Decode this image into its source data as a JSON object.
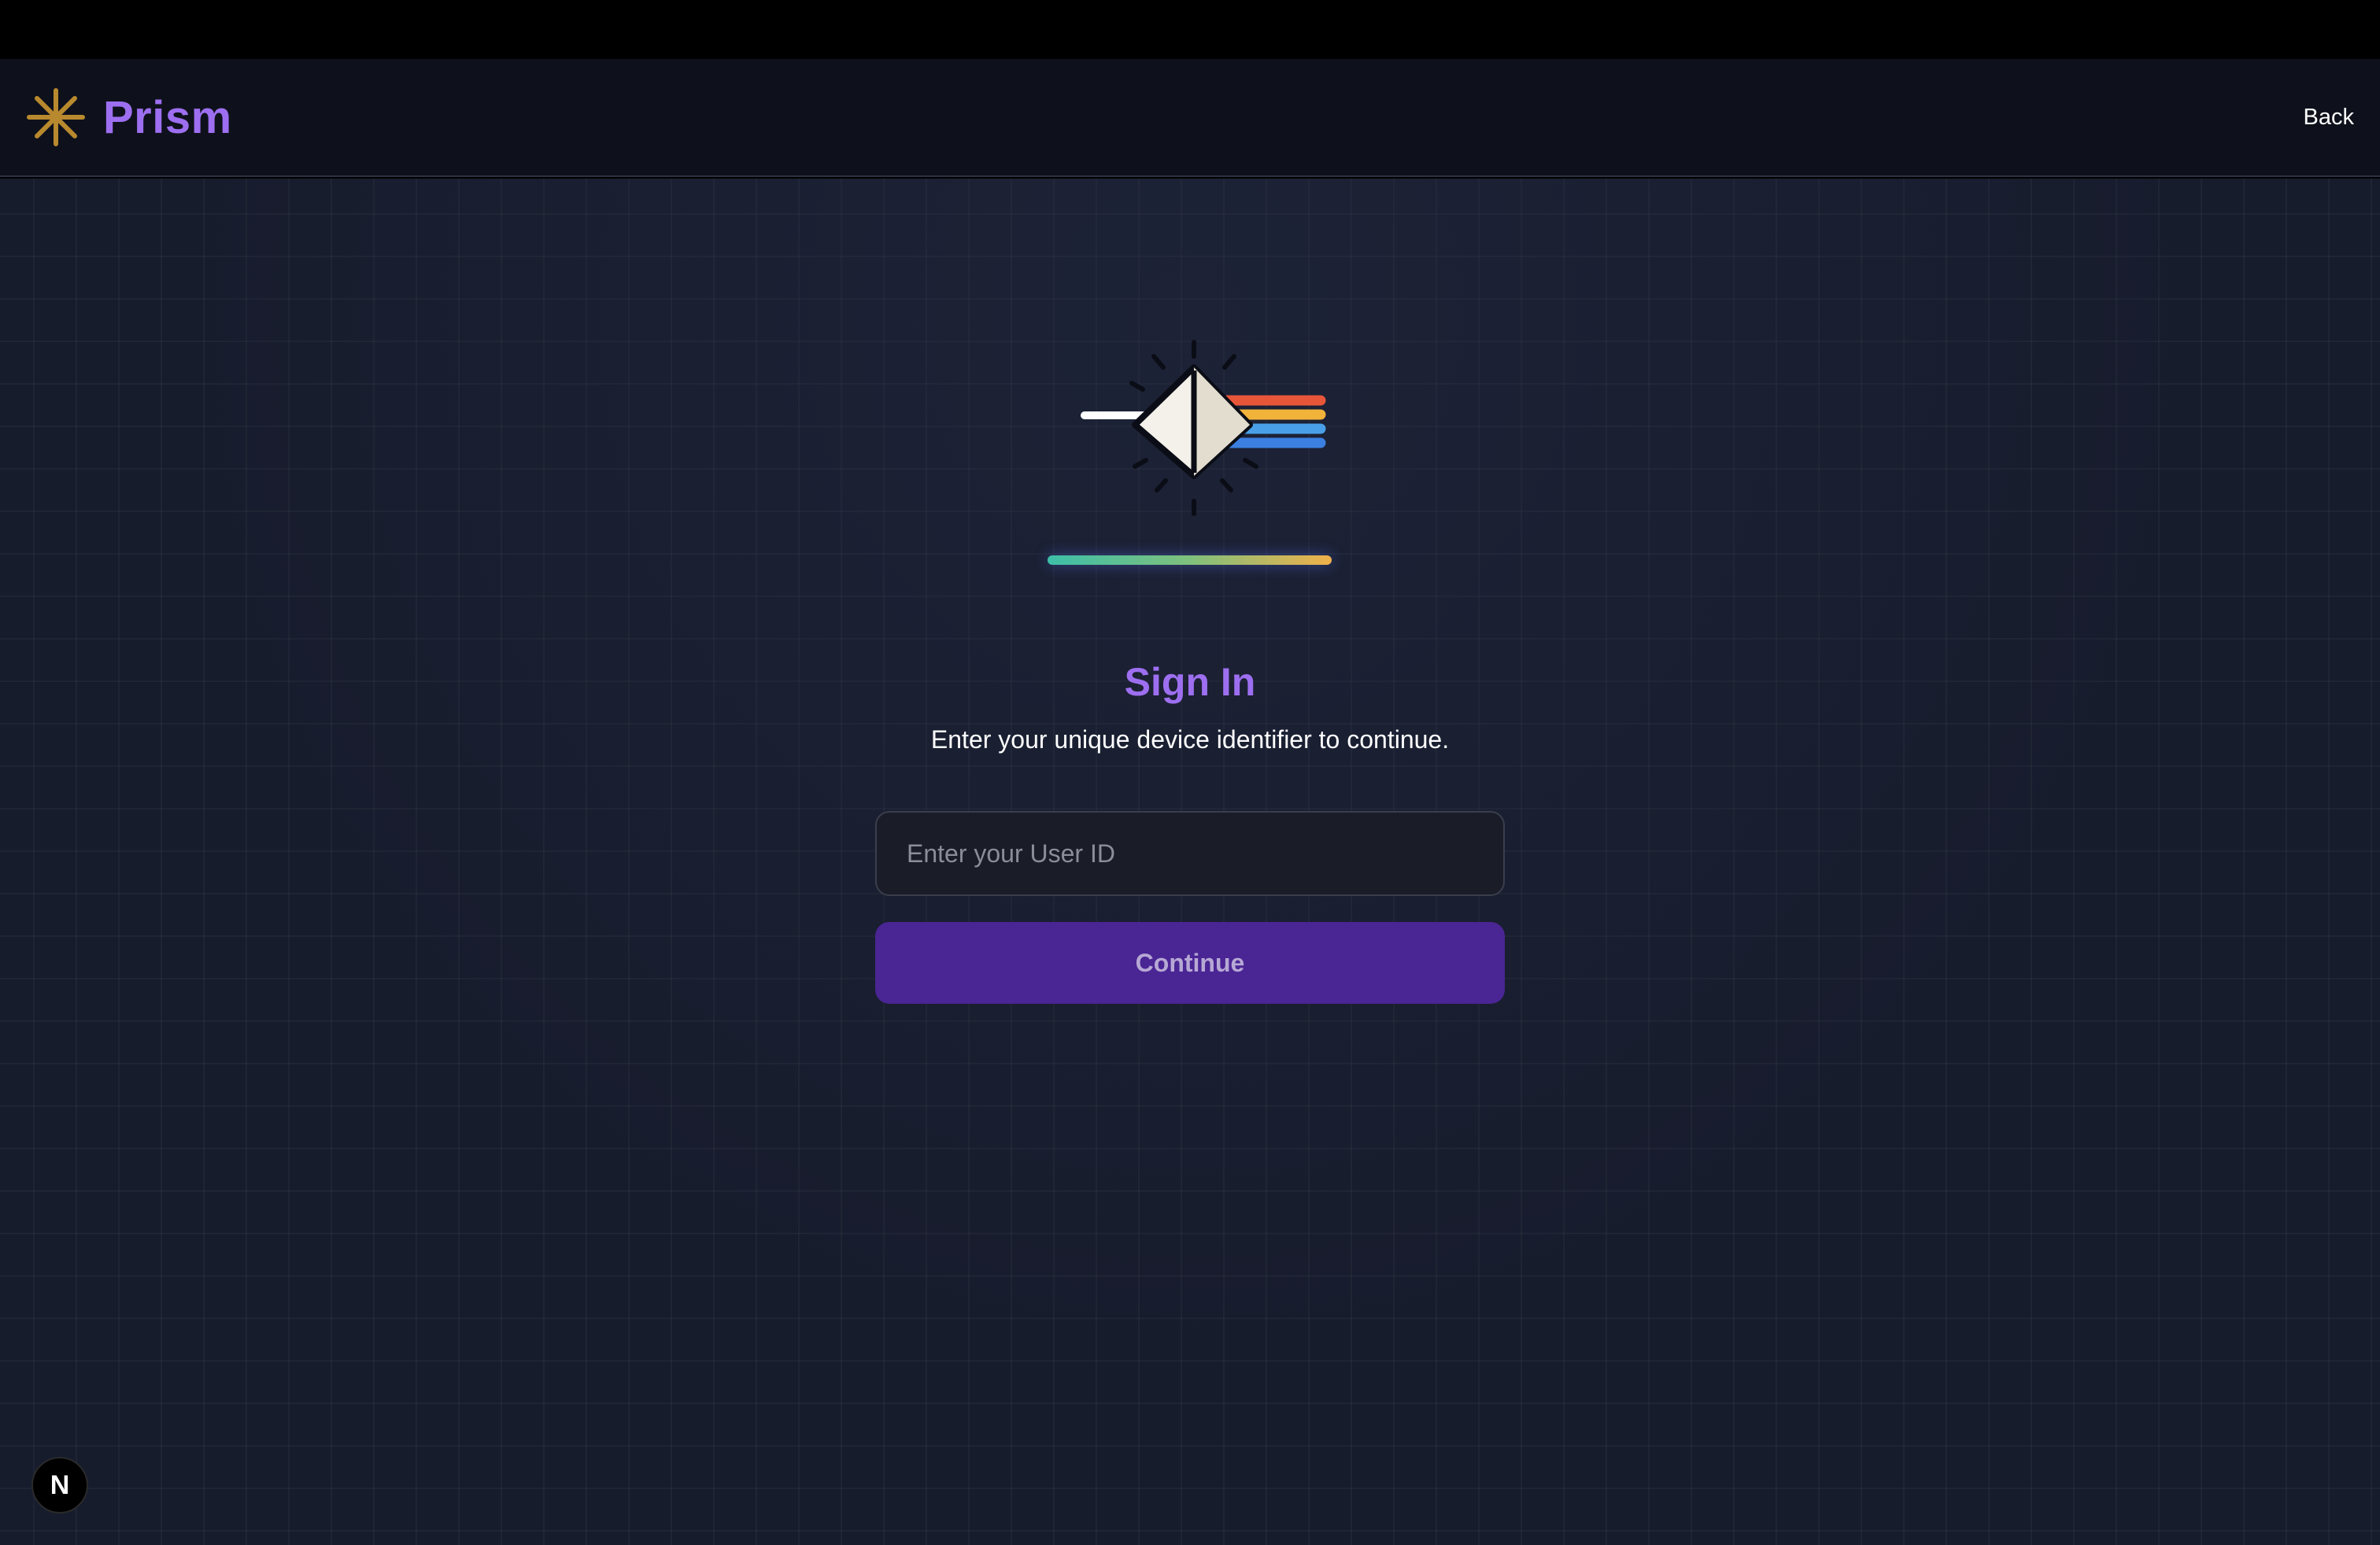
{
  "app": {
    "brand_name": "Prism",
    "brand_icon": "asterisk-sparkle-icon",
    "brand_color": "#9d6ff0",
    "accent_gold": "#b8892e"
  },
  "header": {
    "back_label": "Back"
  },
  "hero": {
    "illustration": "prism-rainbow-icon",
    "spectrum_colors": [
      "#e8563a",
      "#f2b33b",
      "#4aa0e8",
      "#3b7fe0"
    ]
  },
  "signin": {
    "title": "Sign In",
    "subtitle": "Enter your unique device identifier to continue.",
    "input_placeholder": "Enter your User ID",
    "input_value": "",
    "continue_label": "Continue"
  },
  "dev_badge": {
    "label": "N",
    "icon": "nextjs-dev-indicator-icon"
  }
}
